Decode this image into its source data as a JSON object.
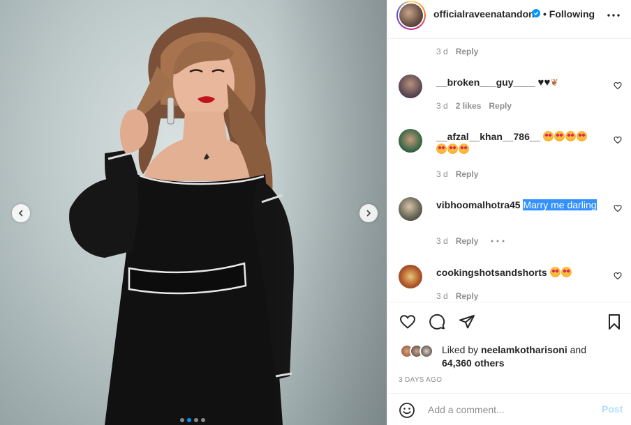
{
  "post": {
    "author": "officialraveenatandon",
    "follow_status": "• Following",
    "carousel_total": 4,
    "carousel_index": 2
  },
  "comments": [
    {
      "username": "",
      "text": "",
      "time": "3 d",
      "likes": "",
      "reply": "Reply"
    },
    {
      "username": "__broken___guy____",
      "text": "",
      "emojis": [
        "black-heart",
        "black-heart",
        "butterfly"
      ],
      "time": "3 d",
      "likes": "2 likes",
      "reply": "Reply"
    },
    {
      "username": "__afzal__khan__786__",
      "text": "",
      "emojis": [
        "star-struck",
        "star-struck",
        "star-struck",
        "star-struck",
        "star-struck",
        "star-struck",
        "star-struck"
      ],
      "time": "3 d",
      "likes": "",
      "reply": "Reply"
    },
    {
      "username": "vibhoomalhotra45",
      "text": "Marry me darling",
      "time": "3 d",
      "likes": "",
      "reply": "Reply"
    },
    {
      "username": "cookingshotsandshorts",
      "text": "",
      "emojis": [
        "star-struck",
        "star-struck"
      ],
      "time": "3 d",
      "likes": "",
      "reply": "Reply"
    }
  ],
  "likes": {
    "prefix": "Liked by",
    "top_user": "neelamkotharisoni",
    "joiner": "and",
    "others": "64,360 others"
  },
  "timestamp": "3 DAYS AGO",
  "composer": {
    "placeholder": "Add a comment...",
    "post_label": "Post"
  },
  "colors": {
    "accent": "#0095f6",
    "post_disabled": "#b2dffc",
    "meta_gray": "#8e8e8e",
    "highlight": "#3391ff"
  }
}
